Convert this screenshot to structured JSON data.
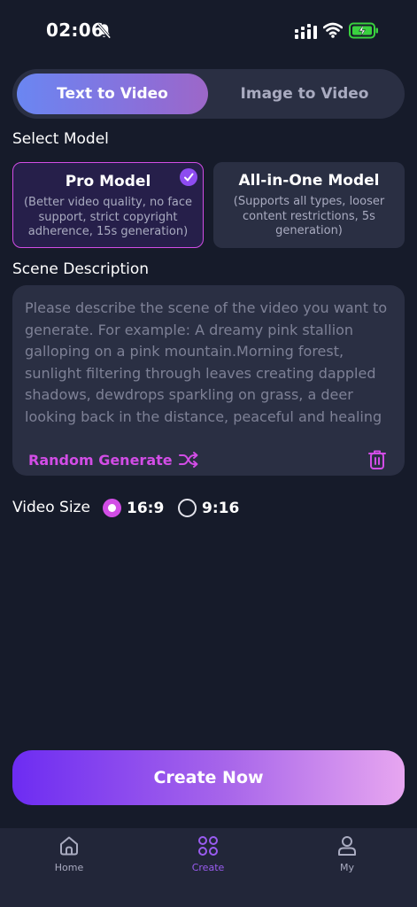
{
  "status_bar": {
    "time": "02:06",
    "icons": [
      "bell-off-icon",
      "signal-icon",
      "wifi-icon",
      "battery-charging-icon"
    ]
  },
  "mode_tabs": [
    {
      "label": "Text to Video",
      "active": true
    },
    {
      "label": "Image to Video",
      "active": false
    }
  ],
  "select_model": {
    "label": "Select Model",
    "options": [
      {
        "title": "Pro Model",
        "description": "(Better video quality, no face support, strict copyright adherence, 15s generation)",
        "selected": true
      },
      {
        "title": "All-in-One Model",
        "description": "(Supports all types, looser content restrictions, 5s generation)",
        "selected": false
      }
    ]
  },
  "scene": {
    "label": "Scene Description",
    "placeholder": "Please describe the scene of the video you want to generate. For example: A dreamy pink stallion galloping on a pink mountain.Morning forest, sunlight filtering through leaves creating dappled shadows, dewdrops sparkling on grass, a deer looking back in the distance, peaceful and healing scene",
    "value": "",
    "random_label": "Random Generate"
  },
  "video_size": {
    "label": "Video Size",
    "options": [
      {
        "label": "16:9",
        "selected": true
      },
      {
        "label": "9:16",
        "selected": false
      }
    ]
  },
  "create_button": {
    "label": "Create Now"
  },
  "bottom_nav": [
    {
      "label": "Home",
      "icon": "home-icon",
      "active": false
    },
    {
      "label": "Create",
      "icon": "create-icon",
      "active": true
    },
    {
      "label": "My",
      "icon": "profile-icon",
      "active": false
    }
  ],
  "colors": {
    "background": "#161b2a",
    "surface": "#2a2f43",
    "accent_magenta": "#d24de6",
    "accent_purple": "#9a5cf0",
    "muted_text": "#a9abc0"
  }
}
